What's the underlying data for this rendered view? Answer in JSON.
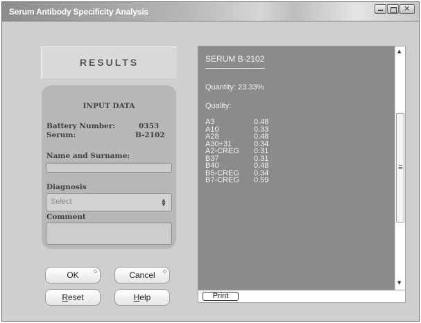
{
  "window": {
    "title": "Serum Antibody Specificity Analysis"
  },
  "results_header": "RESULTS",
  "input_data": {
    "title": "INPUT DATA",
    "battery_label": "Battery Number:",
    "battery_value": "0353",
    "serum_label": "Serum:",
    "serum_value": "B-2102",
    "name_label": "Name and Surname:",
    "name_value": "",
    "diagnosis_label": "Diagnosis",
    "diagnosis_placeholder": "Select",
    "comment_label": "Comment",
    "comment_value": ""
  },
  "buttons": {
    "ok": "OK",
    "cancel": "Cancel",
    "reset_underlined": "R",
    "reset_rest": "eset",
    "help_underlined": "H",
    "help_rest": "elp",
    "print": "Print"
  },
  "report": {
    "serum_heading": "SERUM B-2102",
    "quantity": "Quantity: 23.33%",
    "quality_label": "Quality:",
    "rows": [
      {
        "name": "A3",
        "value": "0.48"
      },
      {
        "name": "A10",
        "value": "0.33"
      },
      {
        "name": "A28",
        "value": "0.48"
      },
      {
        "name": "A30+31",
        "value": "0.34"
      },
      {
        "name": "A2-CREG",
        "value": "0.31"
      },
      {
        "name": "B37",
        "value": "0.31"
      },
      {
        "name": "B40",
        "value": "0.48"
      },
      {
        "name": "B5-CREG",
        "value": "0.34"
      },
      {
        "name": "B7-CREG",
        "value": "0.59"
      }
    ]
  },
  "icons": {
    "minimize": "minimize-icon",
    "maximize": "maximize-icon",
    "close": "close-icon",
    "select_arrows": "up-down-arrows-icon",
    "scroll_up": "scroll-up-arrow-icon",
    "scroll_down": "scroll-down-arrow-icon"
  }
}
